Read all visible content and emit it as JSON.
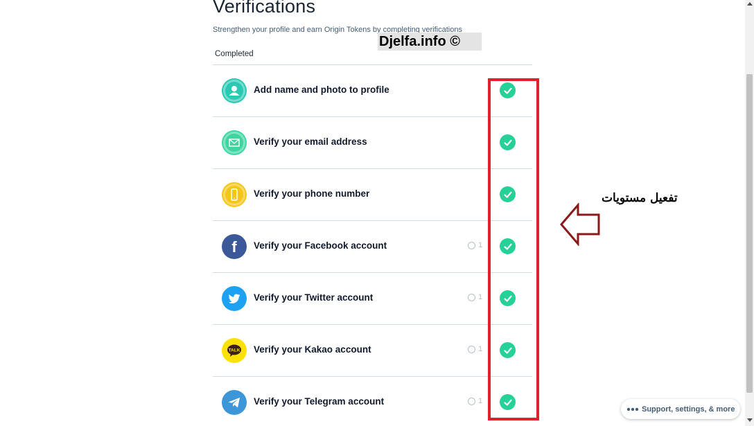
{
  "header": {
    "title": "Verifications",
    "subtitle": "Strengthen your profile and earn Origin Tokens by completing verifications",
    "watermark": "Djelfa.info ©"
  },
  "section": {
    "label": "Completed"
  },
  "rows": [
    {
      "label": "Add name and photo to profile",
      "icon": "profile-icon",
      "reward": ""
    },
    {
      "label": "Verify your email address",
      "icon": "email-icon",
      "reward": ""
    },
    {
      "label": "Verify your phone number",
      "icon": "phone-icon",
      "reward": ""
    },
    {
      "label": "Verify your Facebook account",
      "icon": "facebook-icon",
      "reward": "1"
    },
    {
      "label": "Verify your Twitter account",
      "icon": "twitter-icon",
      "reward": "1"
    },
    {
      "label": "Verify your Kakao account",
      "icon": "kakao-icon",
      "reward": "1"
    },
    {
      "label": "Verify your Telegram account",
      "icon": "telegram-icon",
      "reward": "1"
    }
  ],
  "annotation": {
    "text": "تفعيل مستويات"
  },
  "support": {
    "label": "Support, settings, & more"
  },
  "colors": {
    "check": "#26d198",
    "highlight": "#e0202d",
    "arrow": "#8b1a1a"
  }
}
